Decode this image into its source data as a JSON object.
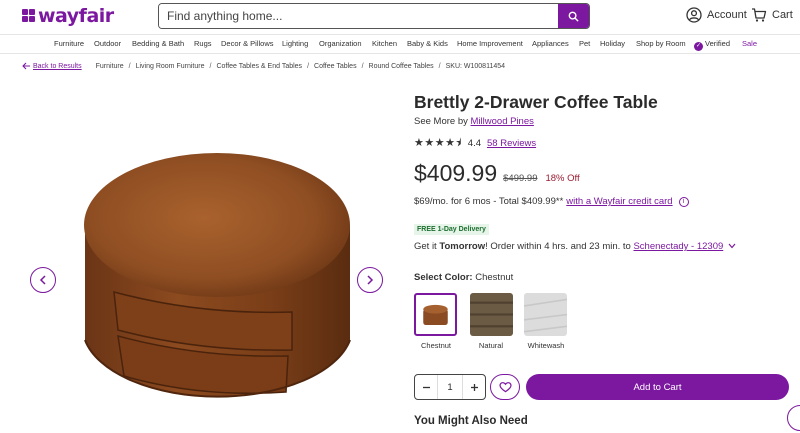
{
  "header": {
    "logo_text": "wayfair",
    "search_placeholder": "Find anything home...",
    "account_label": "Account",
    "cart_label": "Cart"
  },
  "nav": {
    "items": [
      "Furniture",
      "Outdoor",
      "Bedding & Bath",
      "Rugs",
      "Decor & Pillows",
      "Lighting",
      "Organization",
      "Kitchen",
      "Baby & Kids",
      "Home Improvement",
      "Appliances",
      "Pet",
      "Holiday",
      "Shop by Room",
      "Verified",
      "Sale"
    ]
  },
  "breadcrumb": {
    "back_label": "Back to Results",
    "items": [
      "Furniture",
      "Living Room Furniture",
      "Coffee Tables & End Tables",
      "Coffee Tables",
      "Round Coffee Tables"
    ],
    "sku": "SKU: W100811454"
  },
  "product": {
    "title": "Brettly 2-Drawer Coffee Table",
    "see_more_prefix": "See More by",
    "brand": "Millwood Pines",
    "stars": "★★★★⯨",
    "rating": "4.4",
    "reviews": "58 Reviews",
    "price": "$409.99",
    "old_price": "$499.99",
    "discount": "18% Off",
    "finance_text": "$69/mo. for 6 mos - Total $409.99**",
    "finance_link": "with a Wayfair credit card",
    "delivery_badge": "FREE 1-Day Delivery",
    "delivery_prefix": "Get it",
    "delivery_bold": "Tomorrow",
    "delivery_mid": "! Order within 4 hrs. and 23 min. to",
    "delivery_location": "Schenectady - 12309",
    "color_label": "Select Color:",
    "color_value": "Chestnut",
    "swatches": [
      {
        "label": "Chestnut",
        "color": "#8a4a22",
        "selected": true
      },
      {
        "label": "Natural",
        "color": "#6b5a44",
        "selected": false
      },
      {
        "label": "Whitewash",
        "color": "#dcdcdc",
        "selected": false
      }
    ],
    "quantity": "1",
    "add_to_cart": "Add to Cart",
    "also_need": "You Might Also Need"
  },
  "colors": {
    "brand": "#7b189f",
    "wood_dark": "#5e2e12",
    "wood_mid": "#8c4a1f",
    "wood_light": "#a9622e"
  }
}
